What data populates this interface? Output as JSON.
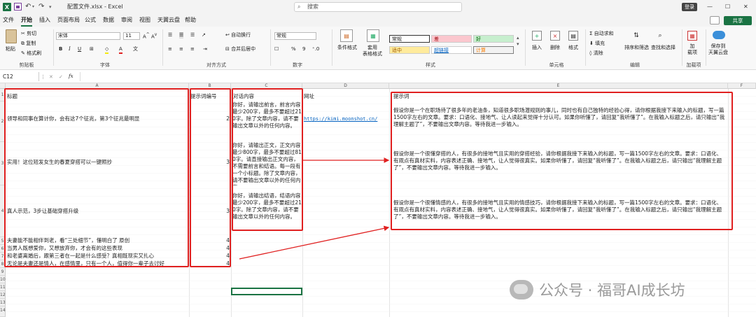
{
  "titlebar": {
    "filename": "配置文件.xlsx",
    "separator": "-",
    "app": "Excel",
    "search_placeholder": "搜索",
    "login": "登录"
  },
  "menu": {
    "tabs": [
      "文件",
      "开始",
      "插入",
      "页面布局",
      "公式",
      "数据",
      "审阅",
      "视图",
      "天翼云盘",
      "帮助"
    ],
    "active": "开始",
    "share": "共享"
  },
  "ribbon": {
    "clipboard": {
      "paste": "粘贴",
      "cut": "剪切",
      "copy": "复制",
      "painter": "格式刷",
      "group": "剪贴板"
    },
    "font": {
      "name": "宋体",
      "size": "11",
      "group": "字体"
    },
    "align": {
      "wrap": "自动换行",
      "merge": "合并后居中",
      "group": "对齐方式"
    },
    "number": {
      "format": "常规",
      "group": "数字"
    },
    "styles": {
      "cond": "条件格式",
      "table": "套用\n表格格式",
      "normal": "常规",
      "bad": "差",
      "good": "好",
      "neutral": "适中",
      "hyperlink": "超链接",
      "calc": "计算",
      "group": "样式"
    },
    "cells": {
      "insert": "插入",
      "delete": "删除",
      "format": "格式",
      "group": "单元格"
    },
    "editing": {
      "autosum": "自动求和",
      "fill": "填充",
      "clear": "清除",
      "sort": "排序和筛选",
      "find": "查找和选择",
      "group": "编辑"
    },
    "addins": {
      "label": "加\n载项",
      "group": "加载项"
    },
    "cloud": {
      "label": "保存到\n天翼云盘"
    }
  },
  "formula": {
    "namebox": "C12",
    "fx": "fx",
    "value": ""
  },
  "sheet": {
    "columns": [
      "A",
      "B",
      "C",
      "D",
      "E",
      "F"
    ],
    "rows": [
      "1",
      "2",
      "3",
      "4",
      "5",
      "6",
      "7",
      "8",
      "9",
      "10",
      "11",
      "12",
      "13",
      "14"
    ],
    "headers": {
      "a": "标题",
      "b": "提示词编号",
      "c": "对话内容",
      "d": "网址",
      "e": "提示词"
    },
    "r2": {
      "a": "领导和同事在算计你，会有这7个征兆，第3个征兆最明显",
      "b": "2",
      "c": "你好，请输出前言，前言内容最少200字，最多不要超过210字。除了文章内容，请不要输出文章以外的任何内容。",
      "d": "https://kimi.moonshot.cn/",
      "e": "假设你是一个在职场待了很多年的老油条，知道很多职场潜规则的事儿，同时也有自己独特的经验心得，请你根据我接下来输入的标题，写一篇1500字左右的文章。要求：口语化、接地气、让人读起来觉得十分认可。如果你听懂了，请回复“我听懂了”。在我输入标题之后，请只输出“我理解主题了”，不要输出文章内容。等待我进一步输入。"
    },
    "r3": {
      "a": "实用！这位短发女生的春夏穿搭可以一键照抄",
      "b": "3",
      "c": "你好，请输出正文，正文内容最少800字，最多不要超过810字。请直接输出正文内容，不需要前言和结语。每一段有一个小标题。除了文章内容，请不要输出文章以外的任何内容。",
      "e": "假设你是一个很懂穿搭的人，有很多的接地气且实用的穿搭经验，请你根据我接下来输入的标题，写一篇1500字左右的文章。要求：口语化、有观点有真材实料，内容表述正确、接地气，让人觉得很真实。如果你听懂了，请回复“我听懂了”。在我输入标题之后，请只输出“我理解主题了”，不要输出文章内容。等待我进一步输入。"
    },
    "r4": {
      "a": "真人示范，3步让基础穿搭升级",
      "b": "3",
      "c": "你好，请输出结语，结语内容最少200字，最多不要超过210字。除了文章内容，请不要输出文章以外的任何内容。",
      "e": "假设你是一个很懂情感的人，有很多的接地气且实用的情感技巧，请你根据我接下来输入的标题，写一篇1500字左右的文章。要求：口语化、有观点有真材实料，内容表述正确、接地气，让人觉得很真实。如果你听懂了，请回复“我听懂了”。在我输入标题之后，请只输出“我理解主题了”，不要输出文章内容。等待我进一步输入。"
    },
    "r5": {
      "a": "夫妻能不能相伴到老，看“三处细节”，懂明白了 原创",
      "b": "4"
    },
    "r6": {
      "a": "当男人既想爱你，又想放弃你，才会有的这些表现",
      "b": "4"
    },
    "r7": {
      "a": "和老婆离婚后，跟第三者在一起是什么感受？真相既现实又扎心",
      "b": "4"
    },
    "r8": {
      "a": "无论是夫妻还是情人，在感情里，只有一个人，值得你一辈子去讨好",
      "b": "4"
    }
  },
  "watermark": "公众号 · 福哥AI成长坊",
  "colors": {
    "accent": "#1a7343",
    "annotation": "#e02020"
  }
}
